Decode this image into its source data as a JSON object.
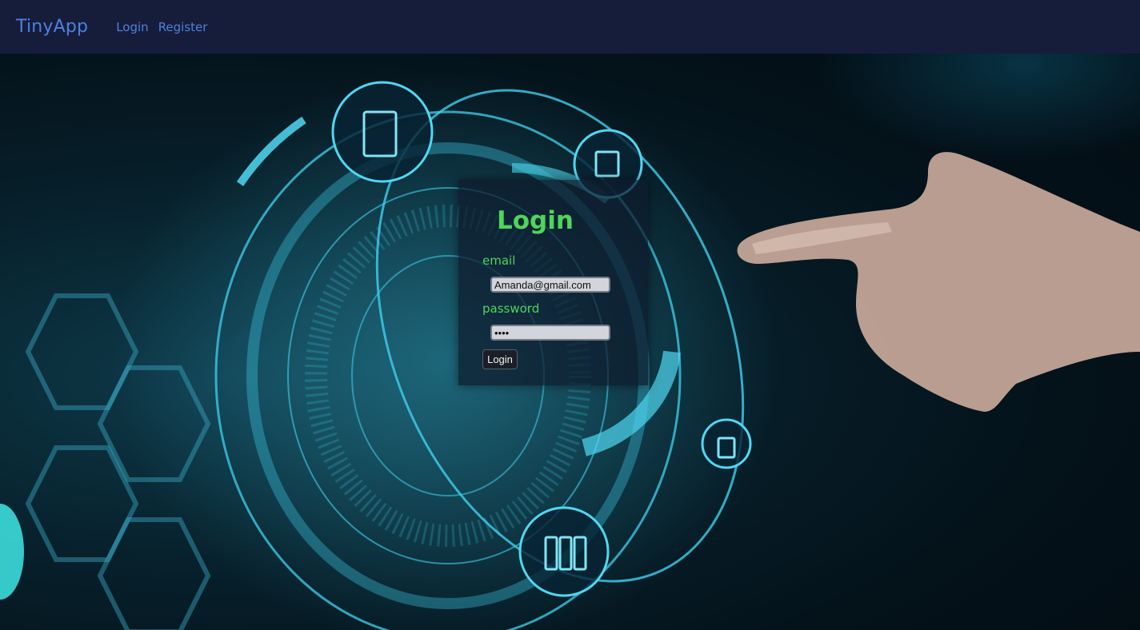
{
  "navbar": {
    "brand": "TinyApp",
    "links": [
      {
        "label": "Login"
      },
      {
        "label": "Register"
      }
    ]
  },
  "login_form": {
    "title": "Login",
    "email_label": "email",
    "email_value": "Amanda@gmail.com",
    "password_label": "password",
    "password_value": "••••",
    "submit_label": "Login"
  },
  "colors": {
    "navbar_bg": "#161d3a",
    "nav_link": "#4f7fe0",
    "accent_green": "#4ed65a",
    "glow_cyan": "#3fd0ee"
  }
}
